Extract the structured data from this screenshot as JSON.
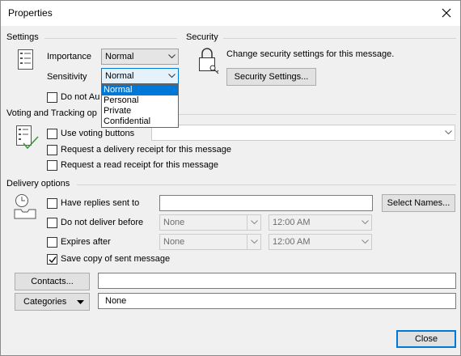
{
  "window": {
    "title": "Properties",
    "close_glyph": "close-icon"
  },
  "settings": {
    "section_label": "Settings",
    "importance_label": "Importance",
    "importance_value": "Normal",
    "sensitivity_label": "Sensitivity",
    "sensitivity_value": "Normal",
    "sensitivity_options": [
      "Normal",
      "Personal",
      "Private",
      "Confidential"
    ],
    "do_not_autoarchive_label": "Do not Au"
  },
  "security": {
    "section_label": "Security",
    "description": "Change security settings for this message.",
    "button_label": "Security Settings..."
  },
  "voting": {
    "section_label": "Voting and Tracking op",
    "use_voting_buttons_label": "Use voting buttons",
    "use_voting_buttons_value": "",
    "delivery_receipt_label": "Request a delivery receipt for this message",
    "read_receipt_label": "Request a read receipt for this message"
  },
  "delivery": {
    "section_label": "Delivery options",
    "have_replies_sent_to_label": "Have replies sent to",
    "have_replies_sent_to_value": "",
    "select_names_label": "Select Names...",
    "do_not_deliver_before_label": "Do not deliver before",
    "do_not_deliver_before_date": "None",
    "do_not_deliver_before_time": "12:00 AM",
    "expires_after_label": "Expires after",
    "expires_after_date": "None",
    "expires_after_time": "12:00 AM",
    "save_copy_label": "Save copy of sent message",
    "save_copy_checked": true
  },
  "contacts": {
    "button_label": "Contacts...",
    "value": ""
  },
  "categories": {
    "button_label": "Categories",
    "value": "None"
  },
  "footer": {
    "close_label": "Close"
  },
  "colors": {
    "accent": "#0078d7",
    "dialog_bg": "#f0f0f0",
    "separator": "#d4d4d4"
  }
}
